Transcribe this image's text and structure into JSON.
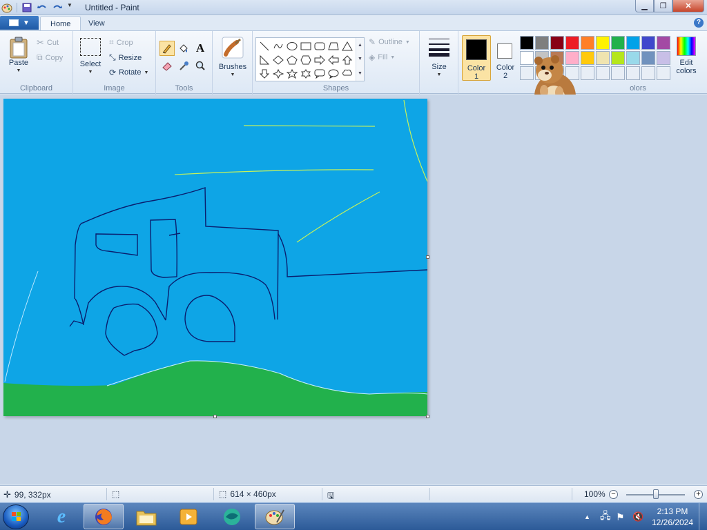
{
  "window": {
    "title": "Untitled - Paint"
  },
  "tabs": {
    "home": "Home",
    "view": "View"
  },
  "clipboard": {
    "paste": "Paste",
    "cut": "Cut",
    "copy": "Copy",
    "group": "Clipboard"
  },
  "image": {
    "select": "Select",
    "crop": "Crop",
    "resize": "Resize",
    "rotate": "Rotate",
    "group": "Image"
  },
  "tools": {
    "group": "Tools"
  },
  "brushes": {
    "label": "Brushes"
  },
  "shapes": {
    "outline": "Outline",
    "fill": "Fill",
    "group": "Shapes"
  },
  "size": {
    "label": "Size"
  },
  "colors": {
    "color1_line1": "Color",
    "color1_line2": "1",
    "color2_line1": "Color",
    "color2_line2": "2",
    "edit_line1": "Edit",
    "edit_line2": "colors",
    "group_visible": "olors",
    "color1": "#000000",
    "color2": "#ffffff",
    "palette_row1": [
      "#000000",
      "#7f7f7f",
      "#880015",
      "#ed1c24",
      "#ff7f27",
      "#fff200",
      "#22b14c",
      "#00a2e8",
      "#3f48cc",
      "#a349a4"
    ],
    "palette_row2": [
      "#ffffff",
      "#c3c3c3",
      "#b97a57",
      "#ffaec9",
      "#ffc90e",
      "#efe4b0",
      "#b5e61d",
      "#99d9ea",
      "#7092be",
      "#c8bfe7"
    ]
  },
  "canvas": {
    "sky_color": "#0ea5e6",
    "grass_color": "#22b14c",
    "line_color": "#0a1e6e",
    "yellow_line_color": "#c6f25a"
  },
  "status": {
    "cursor_pos": "99, 332px",
    "selection_size": "",
    "image_size": "614 × 460px",
    "zoom": "100%",
    "zoom_level": 0.5
  },
  "taskbar": {
    "time": "2:13 PM",
    "date": "12/26/2024"
  }
}
